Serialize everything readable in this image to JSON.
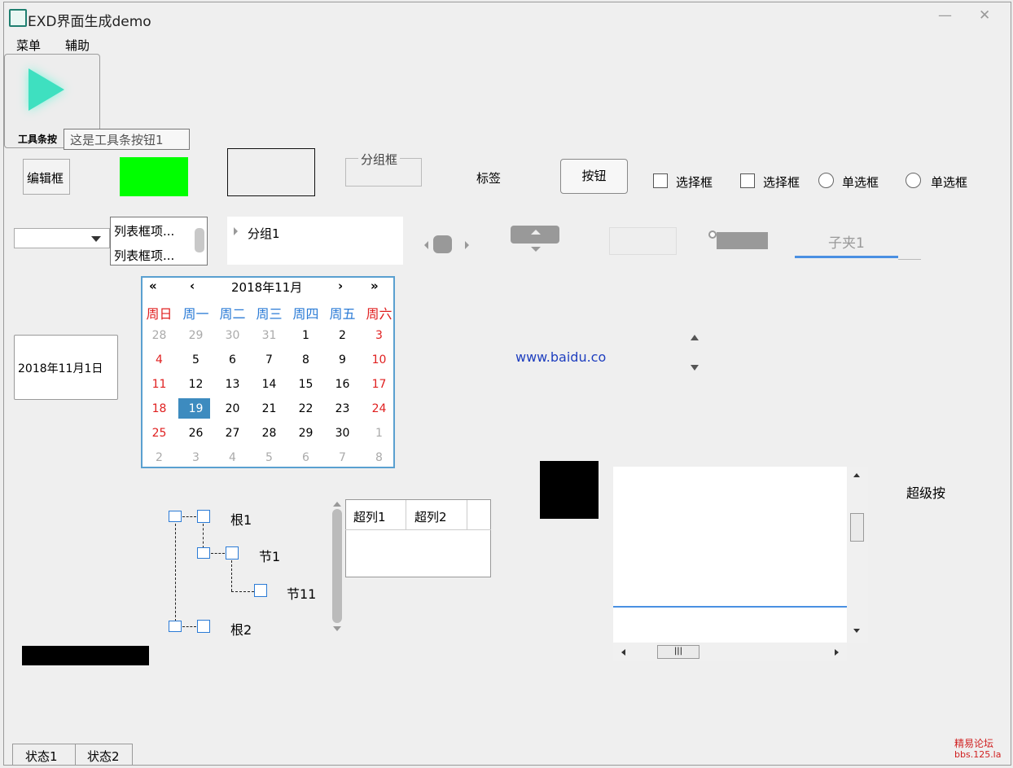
{
  "window": {
    "title": "EXD界面生成demo"
  },
  "menu": {
    "items": [
      "菜单",
      "辅助"
    ]
  },
  "toolbar": {
    "button_text": "工具条按",
    "tooltip": "这是工具条按钮1"
  },
  "controls": {
    "edit_button": "编辑框",
    "group_box": "分组框",
    "label": "标签",
    "button": "按钮",
    "checkbox1": "选择框",
    "checkbox2": "选择框",
    "radio1": "单选框",
    "radio2": "单选框"
  },
  "listbox": {
    "items": [
      "列表框项...",
      "列表框项..."
    ]
  },
  "tree_top": {
    "group": "分组1"
  },
  "tab": {
    "label": "子夹1"
  },
  "datetime": {
    "value": "2018年11月1日"
  },
  "calendar": {
    "header": "2018年11月",
    "nav": {
      "prev_year": "«",
      "prev_month": "‹",
      "next_month": "›",
      "next_year": "»"
    },
    "weekdays": [
      "周日",
      "周一",
      "周二",
      "周三",
      "周四",
      "周五",
      "周六"
    ],
    "weeks": [
      [
        "28",
        "29",
        "30",
        "31",
        "1",
        "2",
        "3"
      ],
      [
        "4",
        "5",
        "6",
        "7",
        "8",
        "9",
        "10"
      ],
      [
        "11",
        "12",
        "13",
        "14",
        "15",
        "16",
        "17"
      ],
      [
        "18",
        "19",
        "20",
        "21",
        "22",
        "23",
        "24"
      ],
      [
        "25",
        "26",
        "27",
        "28",
        "29",
        "30",
        "1"
      ],
      [
        "2",
        "3",
        "4",
        "5",
        "6",
        "7",
        "8"
      ]
    ],
    "selected": "19"
  },
  "link": {
    "text": "www.baidu.co"
  },
  "tree": {
    "nodes": [
      "根1",
      "节1",
      "节11",
      "根2"
    ]
  },
  "list_header": {
    "columns": [
      "超列1",
      "超列2"
    ]
  },
  "super_button": {
    "label": "超级按"
  },
  "statusbar": {
    "items": [
      "状态1",
      "状态2"
    ]
  },
  "watermark": {
    "line1": "精易论坛",
    "line2": "bbs.125.la"
  },
  "colors": {
    "accent": "#4a90e2",
    "green_block": "#00ff00",
    "calendar_selected": "#3d8bbf",
    "weekend": "#e02020"
  }
}
